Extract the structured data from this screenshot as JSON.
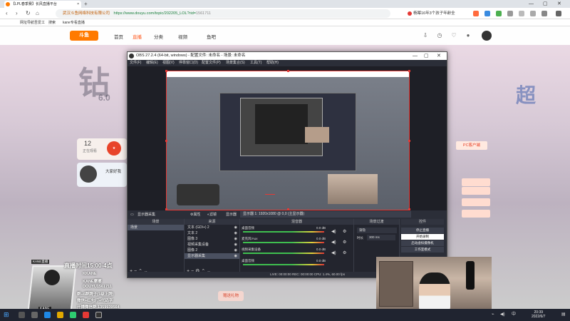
{
  "browser": {
    "tab_title": "【LPL春季赛】长风直播平台",
    "url_site": "武汉斗鱼网络科技有限公司",
    "url_main": "https://www.douyu.com/topic/202205_LOL?rid=",
    "url_tail": "1561711",
    "hot_text": "杨幂16年3个孩子年龄全",
    "new_tab": "+",
    "back": "‹",
    "forward": "›",
    "reload": "↻",
    "home": "⌂",
    "min": "—",
    "max": "▢",
    "close": "✕",
    "bookmarks": [
      "网址导航",
      "吾爱工",
      "搜索",
      "kane专看直播"
    ]
  },
  "site": {
    "logo": "斗鱼",
    "nav": [
      "首页",
      "直播",
      "分类",
      "视频",
      "鱼吧"
    ],
    "banner": "钻",
    "banner_sub": "6.0",
    "banner_right": "超",
    "stat_number": "12",
    "stat_sub": "正在观看",
    "streamer_name": "大家好我",
    "pc_btn": "PC客户端",
    "gift_btn": "赠送礼物"
  },
  "obs": {
    "title": "OBS 27.2.4 (64-bit, windows) - 配置文件: 未命名 - 场景: 未命名",
    "menu": [
      "文件(F)",
      "编辑(E)",
      "视图(V)",
      "停靠窗口(D)",
      "配置文件(P)",
      "场景集合(S)",
      "工具(T)",
      "帮助(H)"
    ],
    "source_bar": {
      "label": "显示器采集",
      "props": "属性",
      "filters": "滤镜",
      "display_label": "显示器",
      "display_value": "显示器 1: 1920x1080 @ 0,0 (主显示器)"
    },
    "docks": {
      "scenes_title": "场景",
      "scenes": [
        "场景"
      ],
      "sources_title": "来源",
      "sources": [
        "文本 (GDI+) 2",
        "文本 2",
        "图像 3",
        "视频采集设备",
        "图像 2",
        "显示器采集"
      ],
      "mixer_title": "混音器",
      "mixer": [
        {
          "name": "桌面音频",
          "db": "0.0 dB"
        },
        {
          "name": "麦克风/Aux",
          "db": "0.0 dB"
        },
        {
          "name": "视频采集设备",
          "db": "0.0 dB"
        },
        {
          "name": "桌面音频",
          "db": "0.0 dB"
        }
      ],
      "transitions_title": "场景过渡",
      "transition": "渐隐",
      "duration_label": "时长",
      "duration": "300 ms",
      "controls_title": "控件",
      "controls": [
        "停止直播",
        "开始录制",
        "启动虚拟摄像机",
        "工作室模式"
      ]
    },
    "status": "LIVE: 00:00:00   REC: 00:00:00   CPU: 1.4%, 60.00 fps"
  },
  "overlay": {
    "tag": "KANE直播",
    "time": "直播时间15:00-4点",
    "lines": [
      "KKANE",
      "KANE摩擦",
      "DOUYU1561711",
      "群+6群牌子(1级上牌)",
      "微信+红包打+代码字",
      "开播微信群 1359939564"
    ],
    "name": "KANE"
  },
  "taskbar": {
    "start": "⊞",
    "time": "20:39",
    "date": "2022/6/7",
    "lang": "中"
  }
}
